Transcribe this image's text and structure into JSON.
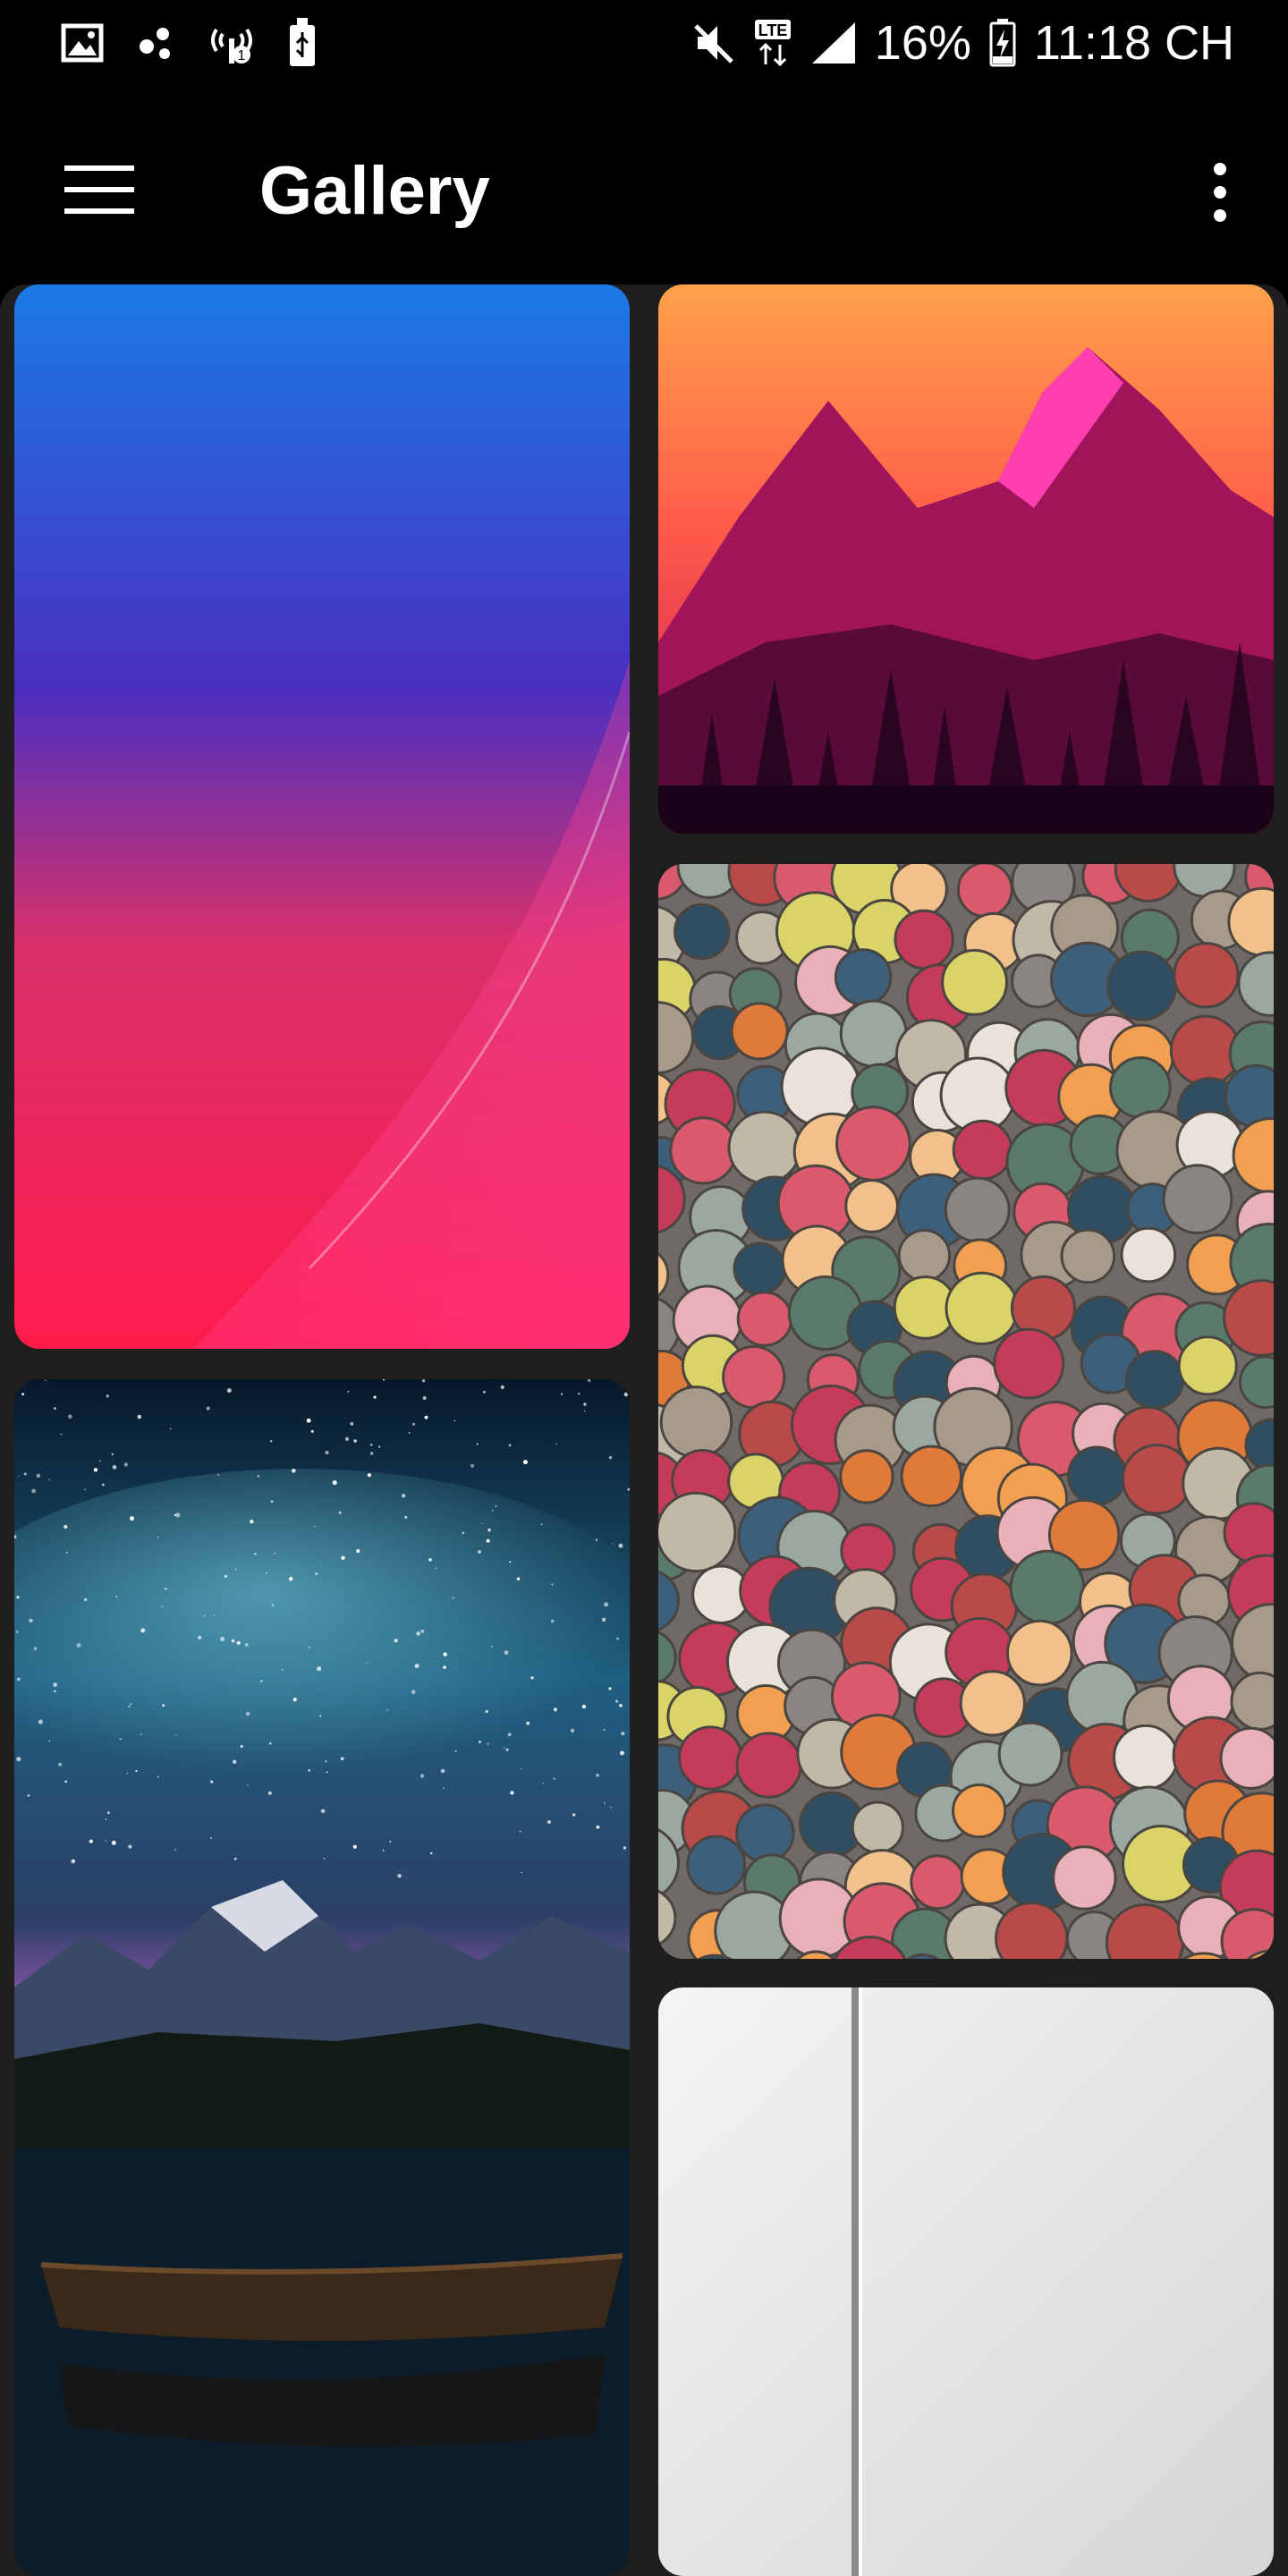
{
  "status_bar": {
    "left_icons": [
      "image-icon",
      "share-dots-icon",
      "hotspot-icon",
      "usb-icon"
    ],
    "right_icons": [
      "mute-icon",
      "lte-icon",
      "signal-icon"
    ],
    "battery": "16%",
    "time": "11:18 CH"
  },
  "app_bar": {
    "title": "Gallery",
    "menu_icon": "hamburger-menu-icon",
    "overflow_icon": "more-vertical-icon"
  },
  "gallery": {
    "items": [
      {
        "name": "blue-pink-gradient-wallpaper",
        "colors": [
          "#1a7ae6",
          "#5a2fc8",
          "#ff1f5a"
        ]
      },
      {
        "name": "pink-mountain-forest-wallpaper",
        "colors": [
          "#ff9a3c",
          "#c2185b",
          "#2a0a1a"
        ]
      },
      {
        "name": "felt-balls-wallpaper",
        "colors": [
          "#3d5f7a",
          "#c43c5a",
          "#f0a050"
        ]
      },
      {
        "name": "starry-sky-boat-wallpaper",
        "colors": [
          "#0b1b2e",
          "#2f7e9e",
          "#c77ac9"
        ]
      },
      {
        "name": "white-minimal-wallpaper",
        "colors": [
          "#f2f2f2",
          "#d8d8d8",
          "#8a8a8a"
        ]
      }
    ]
  }
}
